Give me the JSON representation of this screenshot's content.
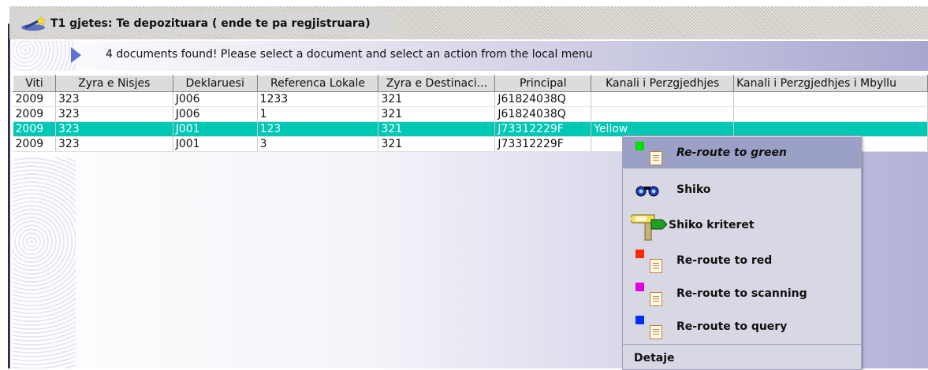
{
  "window": {
    "title": "T1 gjetes: Te depozituara ( ende te pa regjistruara)",
    "title_icon": "magic-wand-icon"
  },
  "message": {
    "text": "4 documents found! Please select a document and select an action from the local menu",
    "icon": "arrow-right-icon"
  },
  "table": {
    "columns": [
      "Viti",
      "Zyra e Nisjes",
      "Deklaruesi",
      "Referenca Lokale",
      "Zyra e Destinaci...",
      "Principal",
      "Kanali i Perzgjedhjes",
      "Kanali i Perzgjedhjes i Mbyllu"
    ],
    "rows": [
      [
        "2009",
        "323",
        "J006",
        "1233",
        "321",
        "J61824038Q",
        "",
        ""
      ],
      [
        "2009",
        "323",
        "J006",
        "1",
        "321",
        "J61824038Q",
        "",
        ""
      ],
      [
        "2009",
        "323",
        "J001",
        "123",
        "321",
        "J73312229F",
        "Yellow",
        ""
      ],
      [
        "2009",
        "323",
        "J001",
        "3",
        "321",
        "J73312229F",
        "",
        ""
      ]
    ],
    "selected_row": 2
  },
  "context_menu": {
    "items": [
      {
        "label": "Re-route to green",
        "icon": "green-square-document-icon",
        "color": "#00e000",
        "active": true
      },
      {
        "label": "Shiko",
        "icon": "binoculars-icon"
      },
      {
        "label": "Shiko kriteret",
        "icon": "signpost-icon"
      },
      {
        "label": "Re-route to red",
        "icon": "red-square-document-icon",
        "color": "#ff2800"
      },
      {
        "label": "Re-route to scanning",
        "icon": "magenta-square-document-icon",
        "color": "#e000e0"
      },
      {
        "label": "Re-route to query",
        "icon": "blue-square-document-icon",
        "color": "#0030ff"
      },
      {
        "label": "Detaje",
        "icon": ""
      }
    ]
  },
  "colors": {
    "selection": "#00c8b4",
    "menu_active": "#9aa0c6",
    "menu_background": "#d8d8e4"
  }
}
